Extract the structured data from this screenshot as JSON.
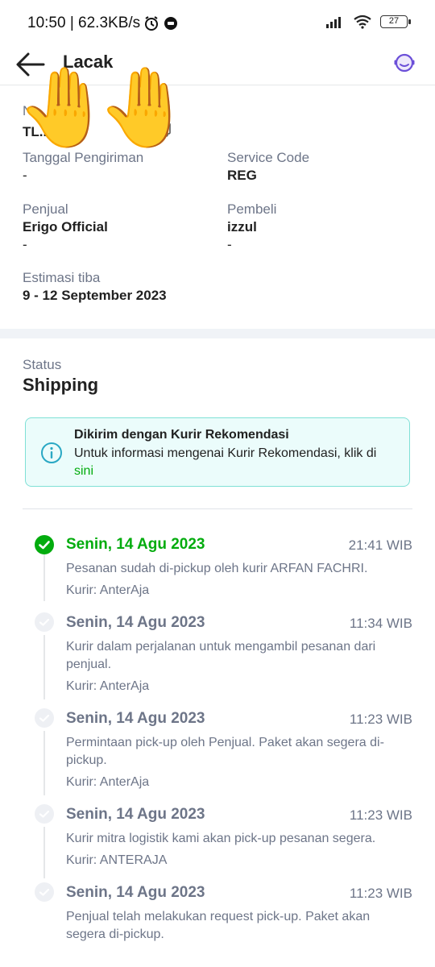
{
  "statusbar": {
    "time_speed": "10:50 | 62.3KB/s",
    "battery": "27"
  },
  "appbar": {
    "title": "Lacak"
  },
  "info": {
    "resi_label": "No. Resi",
    "resi_value": "TL...TE",
    "tanggal_label": "Tanggal Pengiriman",
    "tanggal_value": "-",
    "service_label": "Service Code",
    "service_value": "REG",
    "penjual_label": "Penjual",
    "penjual_name": "Erigo Official",
    "penjual_sub": "-",
    "pembeli_label": "Pembeli",
    "pembeli_name": "izzul",
    "pembeli_sub": "-",
    "estimasi_label": "Estimasi tiba",
    "estimasi_value": "9 - 12 September 2023"
  },
  "status": {
    "label": "Status",
    "value": "Shipping"
  },
  "info_box": {
    "title": "Dikirim dengan Kurir Rekomendasi",
    "text": "Untuk informasi mengenai Kurir Rekomendasi, klik di ",
    "link": "sini"
  },
  "timeline": [
    {
      "date": "Senin, 14 Agu 2023",
      "time": "21:41 WIB",
      "desc": "Pesanan sudah di-pickup oleh kurir ARFAN FACHRI.",
      "courier": "Kurir: AnterAja",
      "active": true
    },
    {
      "date": "Senin, 14 Agu 2023",
      "time": "11:34 WIB",
      "desc": "Kurir dalam perjalanan untuk mengambil pesanan dari penjual.",
      "courier": "Kurir: AnterAja",
      "active": false
    },
    {
      "date": "Senin, 14 Agu 2023",
      "time": "11:23 WIB",
      "desc": "Permintaan pick-up oleh Penjual. Paket akan segera di-pickup.",
      "courier": "Kurir: AnterAja",
      "active": false
    },
    {
      "date": "Senin, 14 Agu 2023",
      "time": "11:23 WIB",
      "desc": "Kurir mitra logistik kami akan pick-up pesanan segera.",
      "courier": "Kurir: ANTERAJA",
      "active": false
    },
    {
      "date": "Senin, 14 Agu 2023",
      "time": "11:23 WIB",
      "desc": "Penjual telah melakukan request pick-up. Paket akan segera di-pickup.",
      "courier": "",
      "active": false
    }
  ],
  "colors": {
    "accent_green": "#03ac0e",
    "muted_text": "#6d7588",
    "info_bg": "#ebfcfb"
  },
  "icons": {
    "back": "arrow-left-icon",
    "help": "headset-icon",
    "copy": "copy-icon",
    "info": "info-circle-icon",
    "check": "check-circle-icon",
    "hands": "raised-hands-emoji"
  }
}
